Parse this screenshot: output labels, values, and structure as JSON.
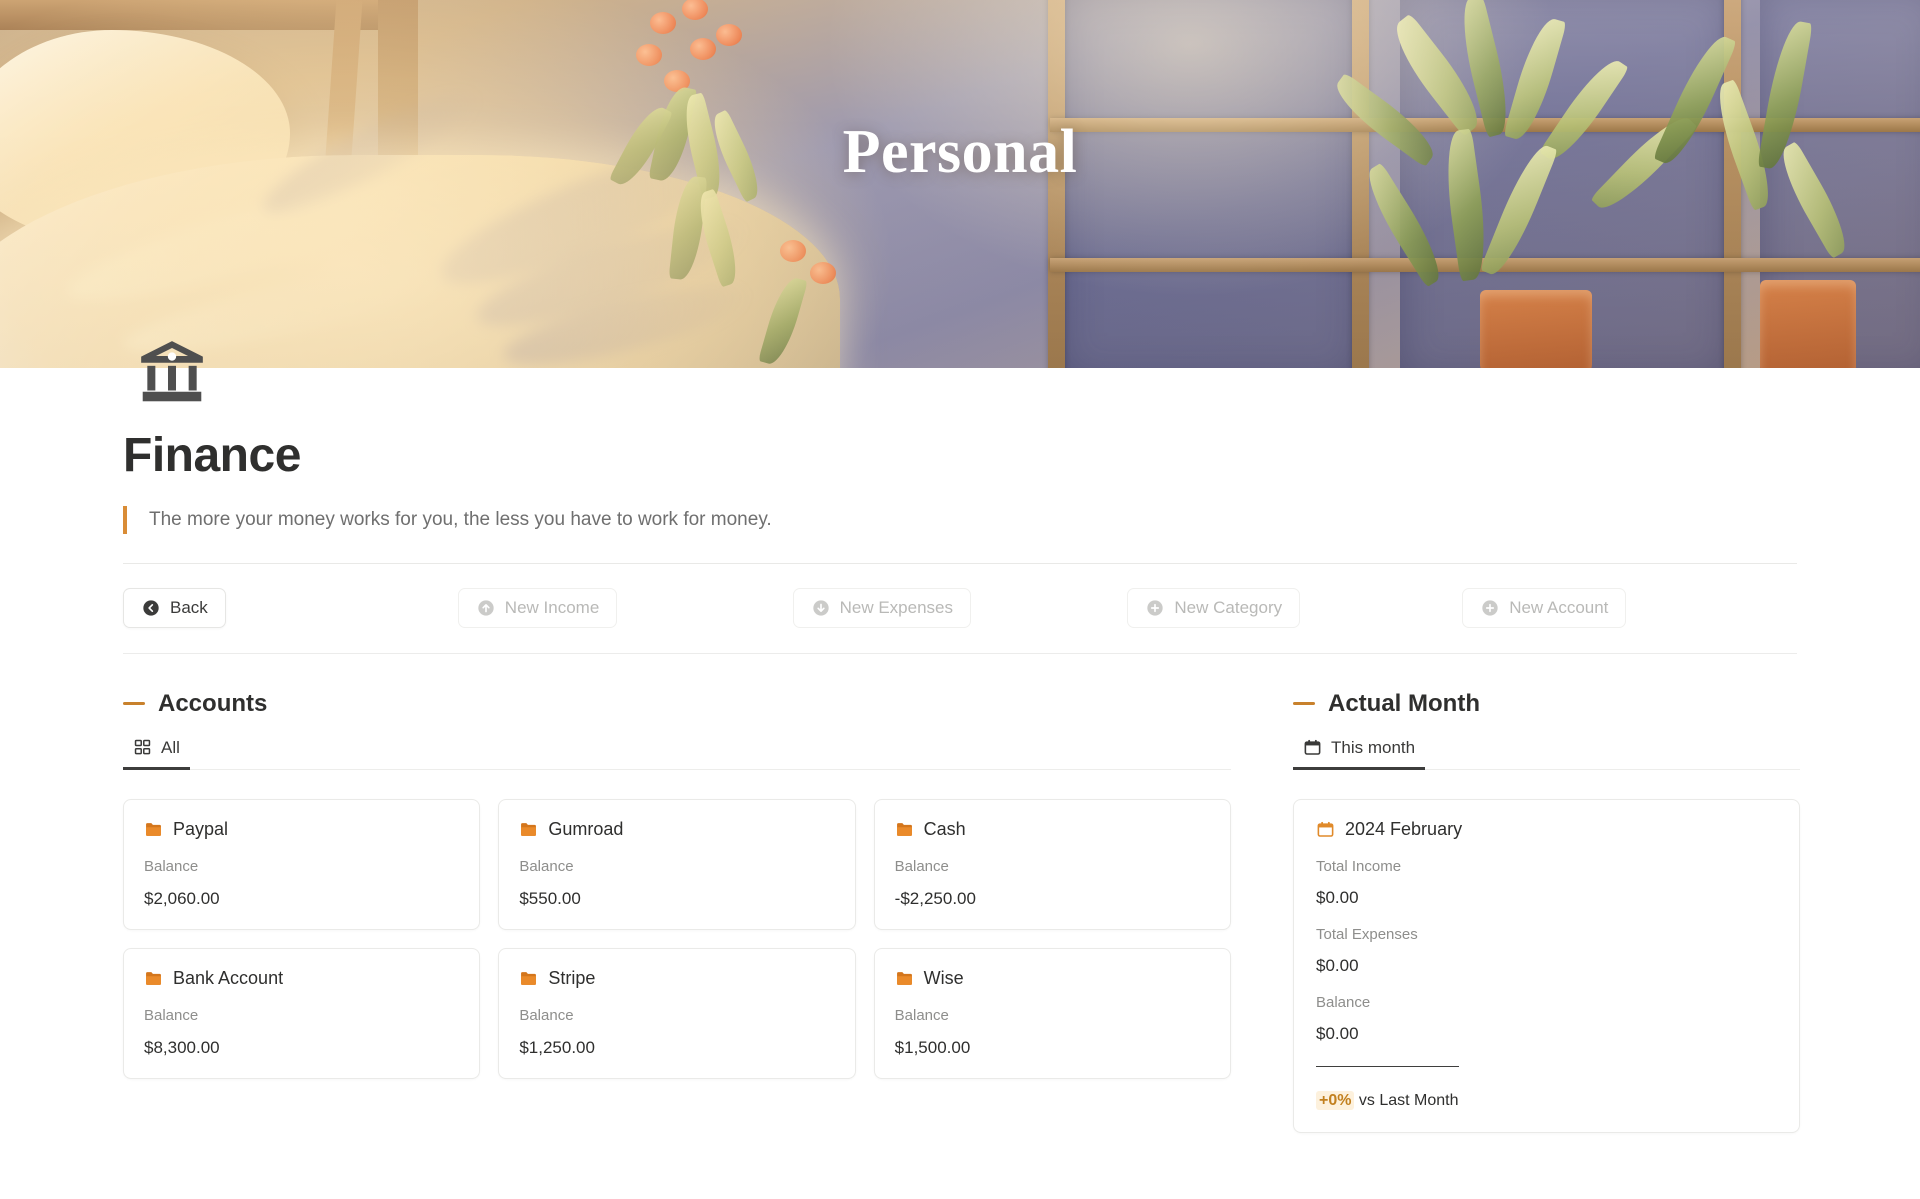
{
  "banner": {
    "title": "Personal",
    "icon": "bank-icon"
  },
  "header": {
    "page_title": "Finance",
    "quote": "The more your money works for you, the less you have to work for money.",
    "accent_color": "#d98c36"
  },
  "actions": [
    {
      "label": "Back",
      "icon": "arrow-left-circle-icon",
      "muted": false
    },
    {
      "label": "New Income",
      "icon": "arrow-up-circle-icon",
      "muted": true
    },
    {
      "label": "New Expenses",
      "icon": "arrow-down-circle-icon",
      "muted": true
    },
    {
      "label": "New Category",
      "icon": "plus-circle-icon",
      "muted": true
    },
    {
      "label": "New Account",
      "icon": "plus-circle-icon",
      "muted": true
    }
  ],
  "accounts_section": {
    "heading": "Accounts",
    "tab": {
      "label": "All",
      "icon": "grid-icon"
    },
    "balance_label": "Balance",
    "cards": [
      {
        "name": "Paypal",
        "label": "Balance",
        "value": "$2,060.00",
        "icon": "folder-icon"
      },
      {
        "name": "Gumroad",
        "label": "Balance",
        "value": "$550.00",
        "icon": "folder-icon"
      },
      {
        "name": "Cash",
        "label": "Balance",
        "value": "-$2,250.00",
        "icon": "folder-icon"
      },
      {
        "name": "Bank Account",
        "label": "Balance",
        "value": "$8,300.00",
        "icon": "folder-icon"
      },
      {
        "name": "Stripe",
        "label": "Balance",
        "value": "$1,250.00",
        "icon": "folder-icon"
      },
      {
        "name": "Wise",
        "label": "Balance",
        "value": "$1,500.00",
        "icon": "folder-icon"
      }
    ]
  },
  "month_section": {
    "heading": "Actual Month",
    "tab": {
      "label": "This month",
      "icon": "calendar-icon"
    },
    "card": {
      "month": "2024 February",
      "icon": "calendar-icon",
      "income_label": "Total Income",
      "income_value": "$0.00",
      "expenses_label": "Total Expenses",
      "expenses_value": "$0.00",
      "balance_label": "Balance",
      "balance_value": "$0.00",
      "change_pct": "+0%",
      "change_suffix": " vs Last Month",
      "change_color": "#c2801f"
    }
  }
}
